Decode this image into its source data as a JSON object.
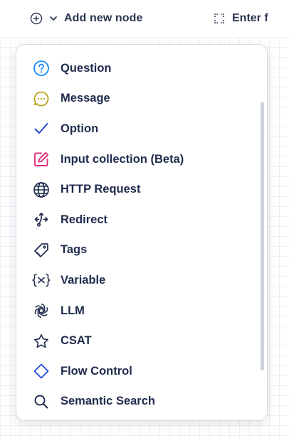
{
  "toolbar": {
    "add_node_label": "Add new node",
    "enter_label": "Enter f"
  },
  "menu": {
    "items": [
      {
        "label": "Question",
        "icon": "question-icon",
        "color": "#1a8cff"
      },
      {
        "label": "Message",
        "icon": "message-icon",
        "color": "#b8a21e"
      },
      {
        "label": "Option",
        "icon": "check-icon",
        "color": "#2046d6"
      },
      {
        "label": "Input collection (Beta)",
        "icon": "edit-icon",
        "color": "#e0307a"
      },
      {
        "label": "HTTP Request",
        "icon": "globe-icon",
        "color": "#1f2b4d"
      },
      {
        "label": "Redirect",
        "icon": "redirect-icon",
        "color": "#1f2b4d"
      },
      {
        "label": "Tags",
        "icon": "tag-icon",
        "color": "#1f2b4d"
      },
      {
        "label": "Variable",
        "icon": "variable-icon",
        "color": "#1f2b4d"
      },
      {
        "label": "LLM",
        "icon": "openai-icon",
        "color": "#1f2b4d"
      },
      {
        "label": "CSAT",
        "icon": "star-icon",
        "color": "#1f2b4d"
      },
      {
        "label": "Flow Control",
        "icon": "diamond-icon",
        "color": "#2046d6"
      },
      {
        "label": "Semantic Search",
        "icon": "search-icon",
        "color": "#1f2b4d"
      }
    ]
  }
}
